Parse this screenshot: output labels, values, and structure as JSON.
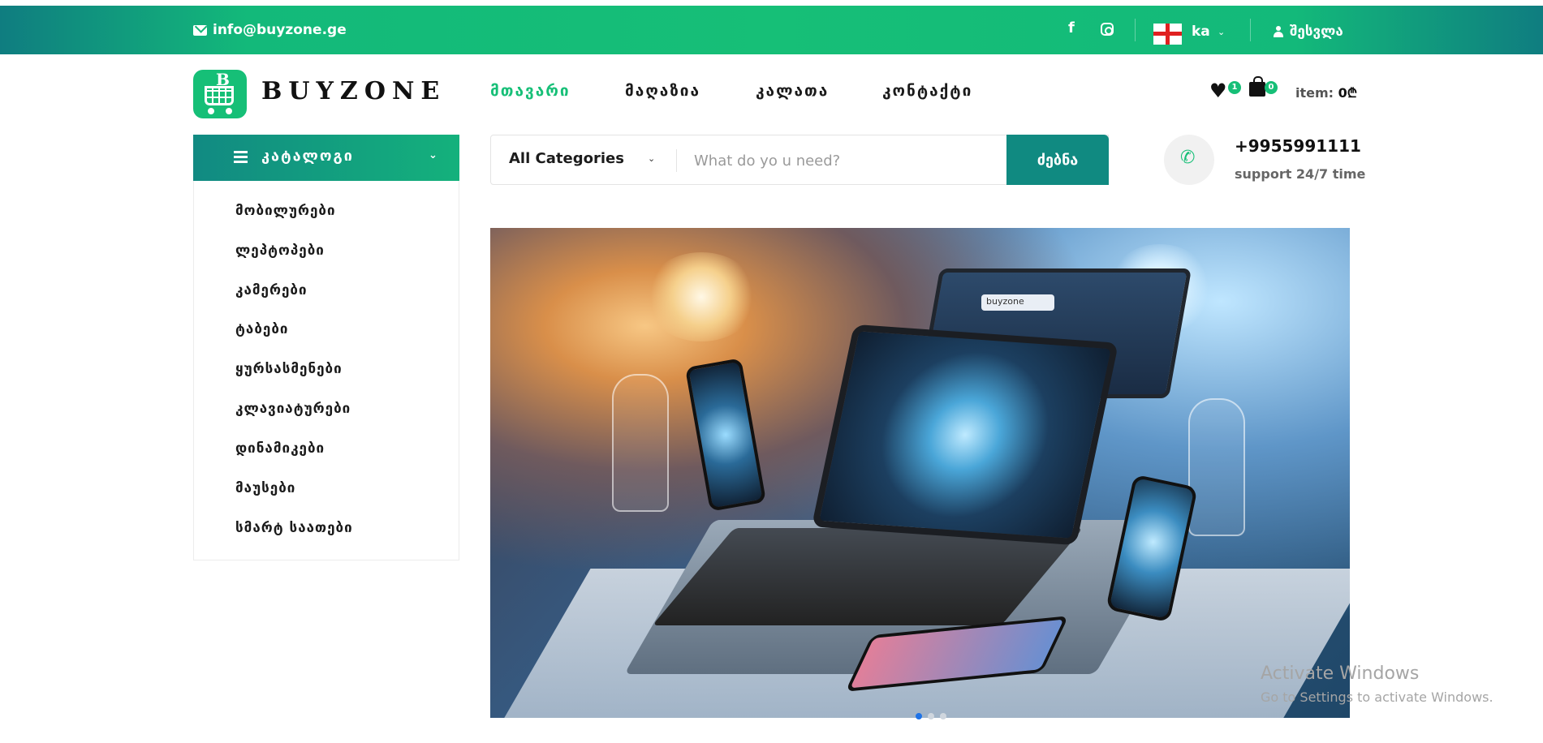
{
  "topbar": {
    "email": "info@buyzone.ge",
    "social": {
      "facebook_glyph": "f"
    },
    "language": "ka",
    "login": "შესვლა"
  },
  "header": {
    "brand": "BUYZONE",
    "logo_letter": "B",
    "nav": [
      {
        "label": "მთავარი",
        "active": true
      },
      {
        "label": "მაღაზია",
        "active": false
      },
      {
        "label": "კალათა",
        "active": false
      },
      {
        "label": "კონტაქტი",
        "active": false
      }
    ],
    "wishlist_count": "1",
    "cart_count": "0",
    "item_label": "item:",
    "item_value": "0₾"
  },
  "catalog": {
    "title": "კატალოგი",
    "items": [
      "მობილურები",
      "ლეპტოპები",
      "კამერები",
      "ტაბები",
      "ყურსასმენები",
      "კლავიატურები",
      "დინამიკები",
      "მაუსები",
      "სმარტ საათები"
    ]
  },
  "search": {
    "category": "All Categories",
    "placeholder": "What do yo u need?",
    "button": "ძებნა"
  },
  "contact": {
    "phone": "+9955991111",
    "support": "support 24/7 time"
  },
  "banner": {
    "screen_text": "buyzone",
    "slides": 3,
    "active_slide": 1
  },
  "os_watermark": {
    "title": "Activate Windows",
    "subtitle": "Go to Settings to activate Windows."
  },
  "colors": {
    "accent": "#16bf77",
    "accent_dark": "#108a81",
    "active_dot": "#1e73e8"
  }
}
